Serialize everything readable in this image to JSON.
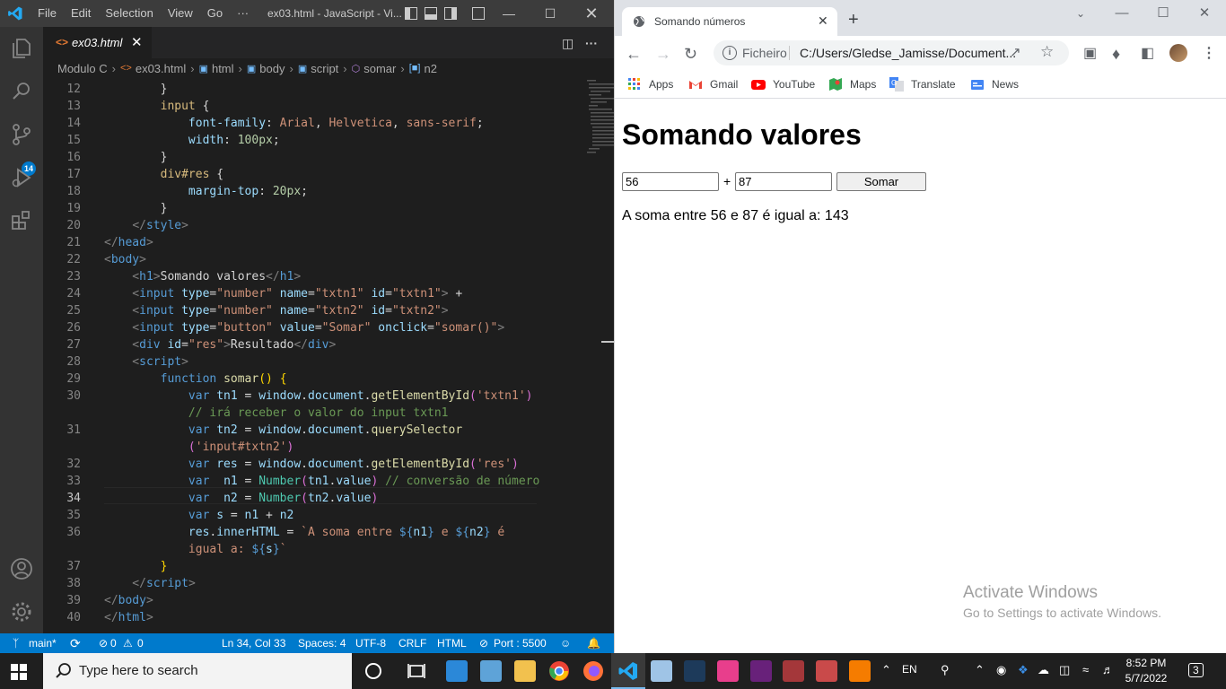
{
  "vscode": {
    "menus": [
      "File",
      "Edit",
      "Selection",
      "View",
      "Go",
      "···"
    ],
    "window_title": "ex03.html - JavaScript - Vi...",
    "tab": {
      "label": "ex03.html"
    },
    "activity_badge": "14",
    "breadcrumb": [
      "Modulo C",
      "ex03.html",
      "html",
      "body",
      "script",
      "somar",
      "n2"
    ],
    "status": {
      "branch": "main*",
      "errors": "0",
      "warnings": "0",
      "position": "Ln 34, Col 33",
      "spaces": "Spaces: 4",
      "encoding": "UTF-8",
      "eol": "CRLF",
      "language": "HTML",
      "port": "Port : 5500"
    },
    "line_numbers": [
      "12",
      "13",
      "14",
      "15",
      "16",
      "17",
      "18",
      "19",
      "20",
      "21",
      "22",
      "23",
      "24",
      "25",
      "26",
      "27",
      "28",
      "29",
      "30",
      "",
      "31",
      "",
      "32",
      "33",
      "34",
      "35",
      "36",
      "",
      "37",
      "38",
      "39",
      "40"
    ]
  },
  "chrome": {
    "tab_title": "Somando números",
    "omnibox_scheme": "Ficheiro",
    "url": "C:/Users/Gledse_Jamisse/Document...",
    "bookmarks": [
      "Apps",
      "Gmail",
      "YouTube",
      "Maps",
      "Translate",
      "News"
    ],
    "page": {
      "heading": "Somando valores",
      "input1": "56",
      "plus": "+",
      "input2": "87",
      "button": "Somar",
      "result": "A soma entre 56 e 87 é igual a: 143"
    },
    "watermark": {
      "title": "Activate Windows",
      "subtitle": "Go to Settings to activate Windows."
    }
  },
  "taskbar": {
    "search_placeholder": "Type here to search",
    "language": "EN",
    "time": "8:52 PM",
    "date": "5/7/2022",
    "notifications": "3"
  },
  "colors": {
    "vscode_status": "#007acc",
    "chrome_tabstrip": "#dee1e6",
    "taskbar": "#1f1f1f"
  }
}
